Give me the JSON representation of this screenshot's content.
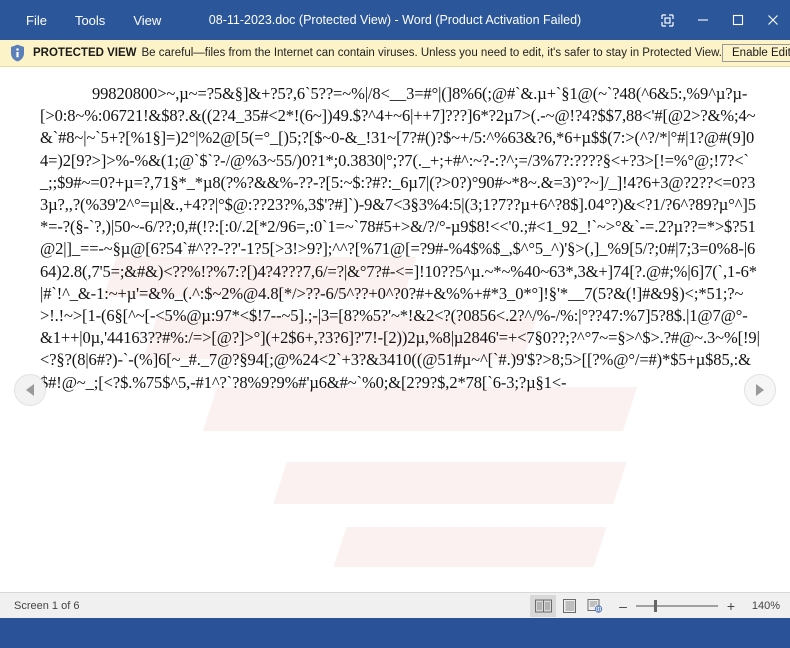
{
  "window": {
    "title": "08-11-2023.doc (Protected View) - Word (Product Activation Failed)",
    "menu": [
      {
        "label": "File",
        "name": "menu-file"
      },
      {
        "label": "Tools",
        "name": "menu-tools"
      },
      {
        "label": "View",
        "name": "menu-view"
      }
    ],
    "caption": {
      "ribbon_display_label": "Ribbon Display Options",
      "minimize_label": "–",
      "maximize_label": "□",
      "close_label": "✕"
    }
  },
  "protected_view": {
    "badge": "PROTECTED VIEW",
    "message": "Be careful—files from the Internet can contain viruses. Unless you need to edit, it's safer to stay in Protected View.",
    "enable_button": "Enable Editing",
    "close_label": "✕",
    "icon": "shield-icon",
    "background_color": "#fdf3c9"
  },
  "document": {
    "body": "99820800>~,µ~=?5&§]&+?5?,6`5??=~%|/8<__3=#°|(]8%6(;@#`&.µ+`§1@(~`?48(^6&5:,%9^µ?µ-[>0:8~%:06721!&$8?.&((2?4_35#<2*!(6~])49.$?^4+~6|++7]???]6*?2µ7>(.-~@!?4?$$7,88<'#[@2>?&%;4~&`#8~|~`5+?[%1§]=)2°|%2@[5(=°_[)5;?[$~0-&_!31~[7?#()?$~+/5:^%63&?6,*6+µ$$(7:>(^?/*|°#|1?@#(9]04=)2[9?>]>%-%&(1;@`$`?-/@%3~55/)0?1*;0.3830|°;?7(._+;+#^:~?-:?^;=/3%7?:????§<+?3>[!=%°@;!7?<`_;;$9#~=0?+µ=?,71§*_*µ8(?%?&&%-??-?[5:~$:?#?:_6µ7|(?>0?)°90#~*8~.&=3)°?~]/_]!4?6+3@?2??<=0?33µ?,,?(%39'2^°=µ|&.,+4??|°$@:??23?%,3$'?#]`)-9&7<3§3%4:5|(3;1?7??µ+6^?8$].04°?)&<?1/?6^?89?µ°^]5*=-?(§-`?,)|50~-6/??;0,#(!?:[:0/.2[*2/96=,:0`1=~`78#5+>&/?/°-µ9$8!<<'0.;#<1_92_!`~>°&`-=.2?µ??=*>$?51@2|]_==-~§µ@[6?54`#^??-??'-1?5[>3!>9?];^^?[%71@[=?9#-%4$%$_,$^°5_^)'§>(,]_%9[5/?;0#|7;3=0%8-|664)2.8(,7'5=;&#&)<??%!?%7:?[)4?4???7,6/=?|&°7?#-<=]!10??5^µ.~*~%40~63*,3&+]74[?.@#;%|6]7(`,1-6*|#`!^_&-1:~+µ'=&%_(.^:$~2%@4.8[*/>??-6/5^??+0^?0?#+&%%+#*3_0*°]!§'*__7(5?&(!]#&9§)<;*51;?~>!.!~>[1-(6§[^~[-<5%@µ:97*<$!7--~5].;-|3=[8?%5?'~*!&2<?(?0856<.2?^/%-/%:|°??47:%7]5?8$.|1@7@°-&1++|0µ,'44163??#%:/=>[@?]>°](+2$6+,?3?6]?'7!-[2))2µ,%8|µ2846'=+<7§0??;?^°7~=§>^$>.?#@~.3~%[!9|<?§?(8|6#?)-`-(%]6[~_#._7@?§94[;@%24<2`+3?&3410((@51#µ~^[`#.)9'$?>8;5>[[?%@°/=#)*$5+µ$85,:&$#!@~_;[<?$.%75$^5,-#1^?`?8%9?9%#'µ6&#~`%0;&[2?9?$,2*78[`6-3;?µ§1<-",
    "nav_prev": "previous-screen",
    "nav_next": "next-screen"
  },
  "status_bar": {
    "screen_info": "Screen 1 of 6",
    "view_modes": [
      {
        "name": "read-mode-icon",
        "label": "Read Mode",
        "active": true
      },
      {
        "name": "print-layout-icon",
        "label": "Print Layout",
        "active": false
      },
      {
        "name": "web-layout-icon",
        "label": "Web Layout",
        "active": false
      }
    ],
    "zoom_out_label": "–",
    "zoom_in_label": "+",
    "zoom_level": "140%"
  },
  "colors": {
    "title_bar": "#2b579a",
    "protected_bar": "#fdf3c9",
    "page": "#ffffff",
    "status_bar": "#f0f0f0"
  }
}
